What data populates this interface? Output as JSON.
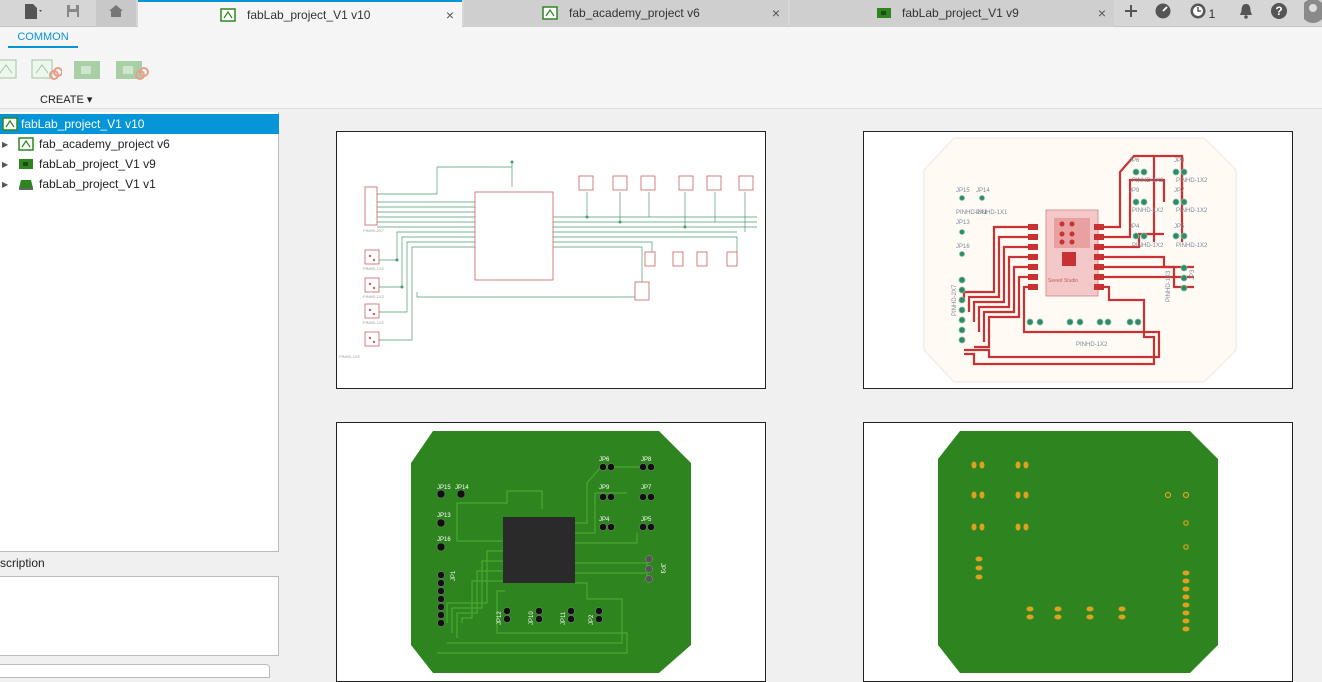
{
  "tabs": [
    {
      "label": "fabLab_project_V1 v10",
      "active": true
    },
    {
      "label": "fab_academy_project v6",
      "active": false
    },
    {
      "label": "fabLab_project_V1 v9",
      "active": false
    }
  ],
  "tab_close": "×",
  "notification_count": "1",
  "toolbar": {
    "common_tab": "COMMON",
    "create_menu": "CREATE ▾"
  },
  "browser": {
    "items": [
      {
        "label": "fabLab_project_V1 v10",
        "selected": true
      },
      {
        "label": "fab_academy_project v6"
      },
      {
        "label": "fabLab_project_V1 v9"
      },
      {
        "label": "fabLab_project_V1 v1"
      }
    ],
    "expand_arrow": "▶"
  },
  "description": {
    "heading": "scription"
  },
  "colors": {
    "accent": "#0696d7",
    "pcb_green": "#2e8520",
    "trace_red": "#c83232",
    "schematic_green": "#4a9a6a"
  },
  "thumbs": {
    "schematic": {
      "labels": [
        "PINHD-2X7",
        "PINHD-1X2",
        "PINHD-1X2",
        "PINHD-1X2",
        "PINHD-1X2"
      ]
    },
    "layout": {
      "labels": [
        "JP6",
        "PINHD-1X2",
        "JP8",
        "PINHD-1X2",
        "JP9",
        "PINHD-1X2",
        "JP7",
        "PINHD-1X2",
        "JP4",
        "PINHD-1X2",
        "JP5",
        "PINHD-1X2",
        "JP15",
        "JP14",
        "PINHD-1X1",
        "PINHD-1X1",
        "JP13",
        "JP16",
        "PINHD-2X7",
        "PINHD-1X2",
        "PINHD-1X3",
        "JP3",
        "Seeed Studio"
      ]
    },
    "board_top": {
      "labels": [
        "JP15",
        "JP14",
        "JP13",
        "JP16",
        "JP6",
        "JP8",
        "JP9",
        "JP7",
        "JP4",
        "JP5",
        "JP1",
        "JP3",
        "JP12",
        "JP10",
        "JP11",
        "JP2"
      ]
    }
  }
}
